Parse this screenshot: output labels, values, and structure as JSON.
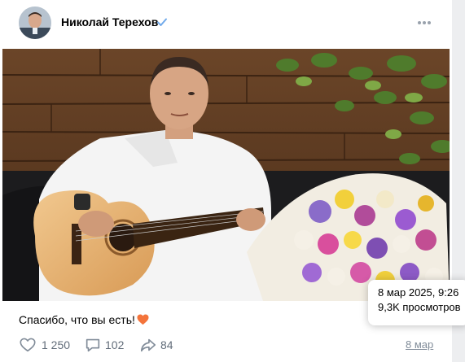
{
  "post": {
    "author_name": "Николай Терехов",
    "verified_icon": "verified-check-icon",
    "more_icon": "more-horizontal-icon",
    "caption_text": "Спасибо, что вы есть!",
    "caption_emoji": "orange-heart-emoji",
    "date_link": "8 мар"
  },
  "actions": {
    "likes": {
      "icon": "heart-icon",
      "count": "1 250"
    },
    "comments": {
      "icon": "comment-icon",
      "count": "102"
    },
    "shares": {
      "icon": "share-icon",
      "count": "84"
    }
  },
  "tooltip": {
    "datetime": "8 мар 2025, 9:26",
    "views": "9,3K просмотров"
  },
  "colors": {
    "accent": "#2688eb",
    "secondary_text": "#626d7a",
    "muted_text": "#818c99",
    "heart_emoji": "#f4743b"
  }
}
